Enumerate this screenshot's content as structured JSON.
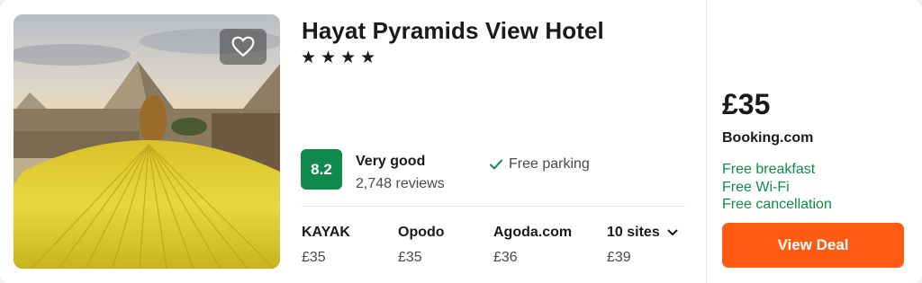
{
  "hotel": {
    "name": "Hayat Pyramids View Hotel",
    "stars": [
      "★",
      "★",
      "★",
      "★"
    ],
    "image_icon": "favorite-heart-icon"
  },
  "rating": {
    "score": "8.2",
    "label": "Very good",
    "reviews": "2,748 reviews",
    "color": "#108a4c"
  },
  "amenities": [
    {
      "icon": "check-icon",
      "label": "Free parking"
    }
  ],
  "sites": [
    {
      "name": "KAYAK",
      "price": "£35"
    },
    {
      "name": "Opodo",
      "price": "£35"
    },
    {
      "name": "Agoda.com",
      "price": "£36"
    },
    {
      "name": "10 sites",
      "price": "£39",
      "icon": "chevron-down-icon"
    }
  ],
  "deal": {
    "price": "£35",
    "provider": "Booking.com",
    "perks": [
      "Free breakfast",
      "Free Wi-Fi",
      "Free cancellation"
    ],
    "perk_color": "#108a4c",
    "button_label": "View Deal",
    "button_color": "#ff5b13"
  }
}
